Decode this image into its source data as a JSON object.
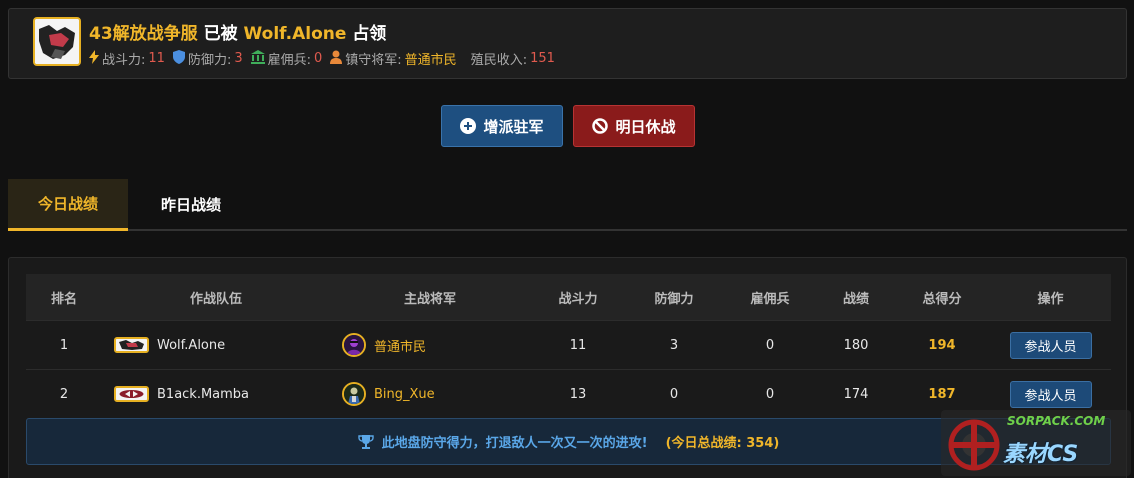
{
  "header": {
    "server_name": "43解放战争服",
    "occupied_text": "已被",
    "occupier": "Wolf.Alone",
    "occupy_suffix": "占领",
    "stats": {
      "power_label": "战斗力:",
      "power_value": "11",
      "defense_label": "防御力:",
      "defense_value": "3",
      "merc_label": "雇佣兵:",
      "merc_value": "0",
      "general_label": "镇守将军:",
      "general_value": "普通市民",
      "income_label": "殖民收入:",
      "income_value": "151"
    }
  },
  "actions": {
    "reinforce_label": "增派驻军",
    "truce_label": "明日休战"
  },
  "tabs": [
    {
      "label": "今日战绩",
      "active": true
    },
    {
      "label": "昨日战绩",
      "active": false
    }
  ],
  "table": {
    "headers": [
      "排名",
      "作战队伍",
      "主战将军",
      "战斗力",
      "防御力",
      "雇佣兵",
      "战绩",
      "总得分",
      "操作"
    ],
    "rows": [
      {
        "rank": "1",
        "team": "Wolf.Alone",
        "general": "普通市民",
        "power": "11",
        "defense": "3",
        "merc": "0",
        "record": "180",
        "total": "194",
        "action": "参战人员"
      },
      {
        "rank": "2",
        "team": "B1ack.Mamba",
        "general": "Bing_Xue",
        "power": "13",
        "defense": "0",
        "merc": "0",
        "record": "174",
        "total": "187",
        "action": "参战人员"
      }
    ]
  },
  "info": {
    "message": "此地盘防守得力，打退敌人一次又一次的进攻!",
    "total": "(今日总战绩: 354)"
  },
  "watermark": {
    "top": "SORPACK.COM",
    "bottom": "素材CS"
  },
  "colors": {
    "accent_gold": "#f0b62a",
    "value_red": "#e05a4e",
    "button_blue": "#1e4f80",
    "button_red": "#8a1b1b",
    "info_blue": "#5aa7e8"
  }
}
